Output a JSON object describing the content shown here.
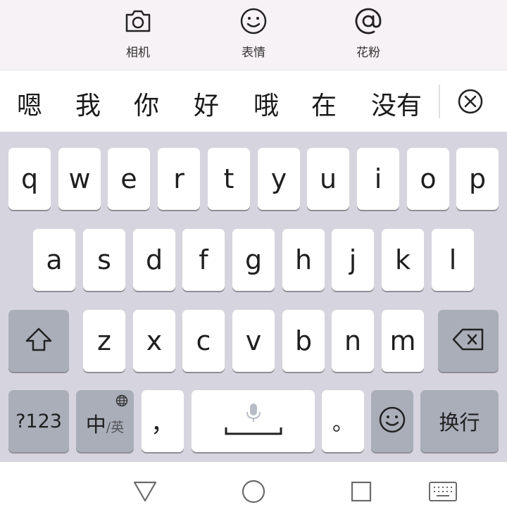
{
  "toolbar": {
    "items": [
      {
        "label": "相机",
        "icon": "camera-icon"
      },
      {
        "label": "表情",
        "icon": "smiley-icon"
      },
      {
        "label": "花粉",
        "icon": "at-icon"
      }
    ]
  },
  "candidates": {
    "words": [
      "嗯",
      "我",
      "你",
      "好",
      "哦",
      "在",
      "没有"
    ],
    "close_icon": "close-circle-icon"
  },
  "keyboard": {
    "row1": [
      "q",
      "w",
      "e",
      "r",
      "t",
      "y",
      "u",
      "i",
      "o",
      "p"
    ],
    "row2": [
      "a",
      "s",
      "d",
      "f",
      "g",
      "h",
      "j",
      "k",
      "l"
    ],
    "row3": [
      "z",
      "x",
      "c",
      "v",
      "b",
      "n",
      "m"
    ],
    "shift_icon": "shift-icon",
    "backspace_icon": "backspace-icon",
    "numbers_label": "?123",
    "lang_main": "中",
    "lang_alt": "/英",
    "globe_icon": "globe-icon",
    "comma_label": "，",
    "space_icon": "microphone-icon",
    "period_label": "。",
    "emoji_icon": "emoji-icon",
    "enter_label": "换行"
  },
  "navbar": {
    "icons": [
      "back-triangle-icon",
      "home-circle-icon",
      "recents-square-icon",
      "keyboard-toggle-icon"
    ]
  }
}
